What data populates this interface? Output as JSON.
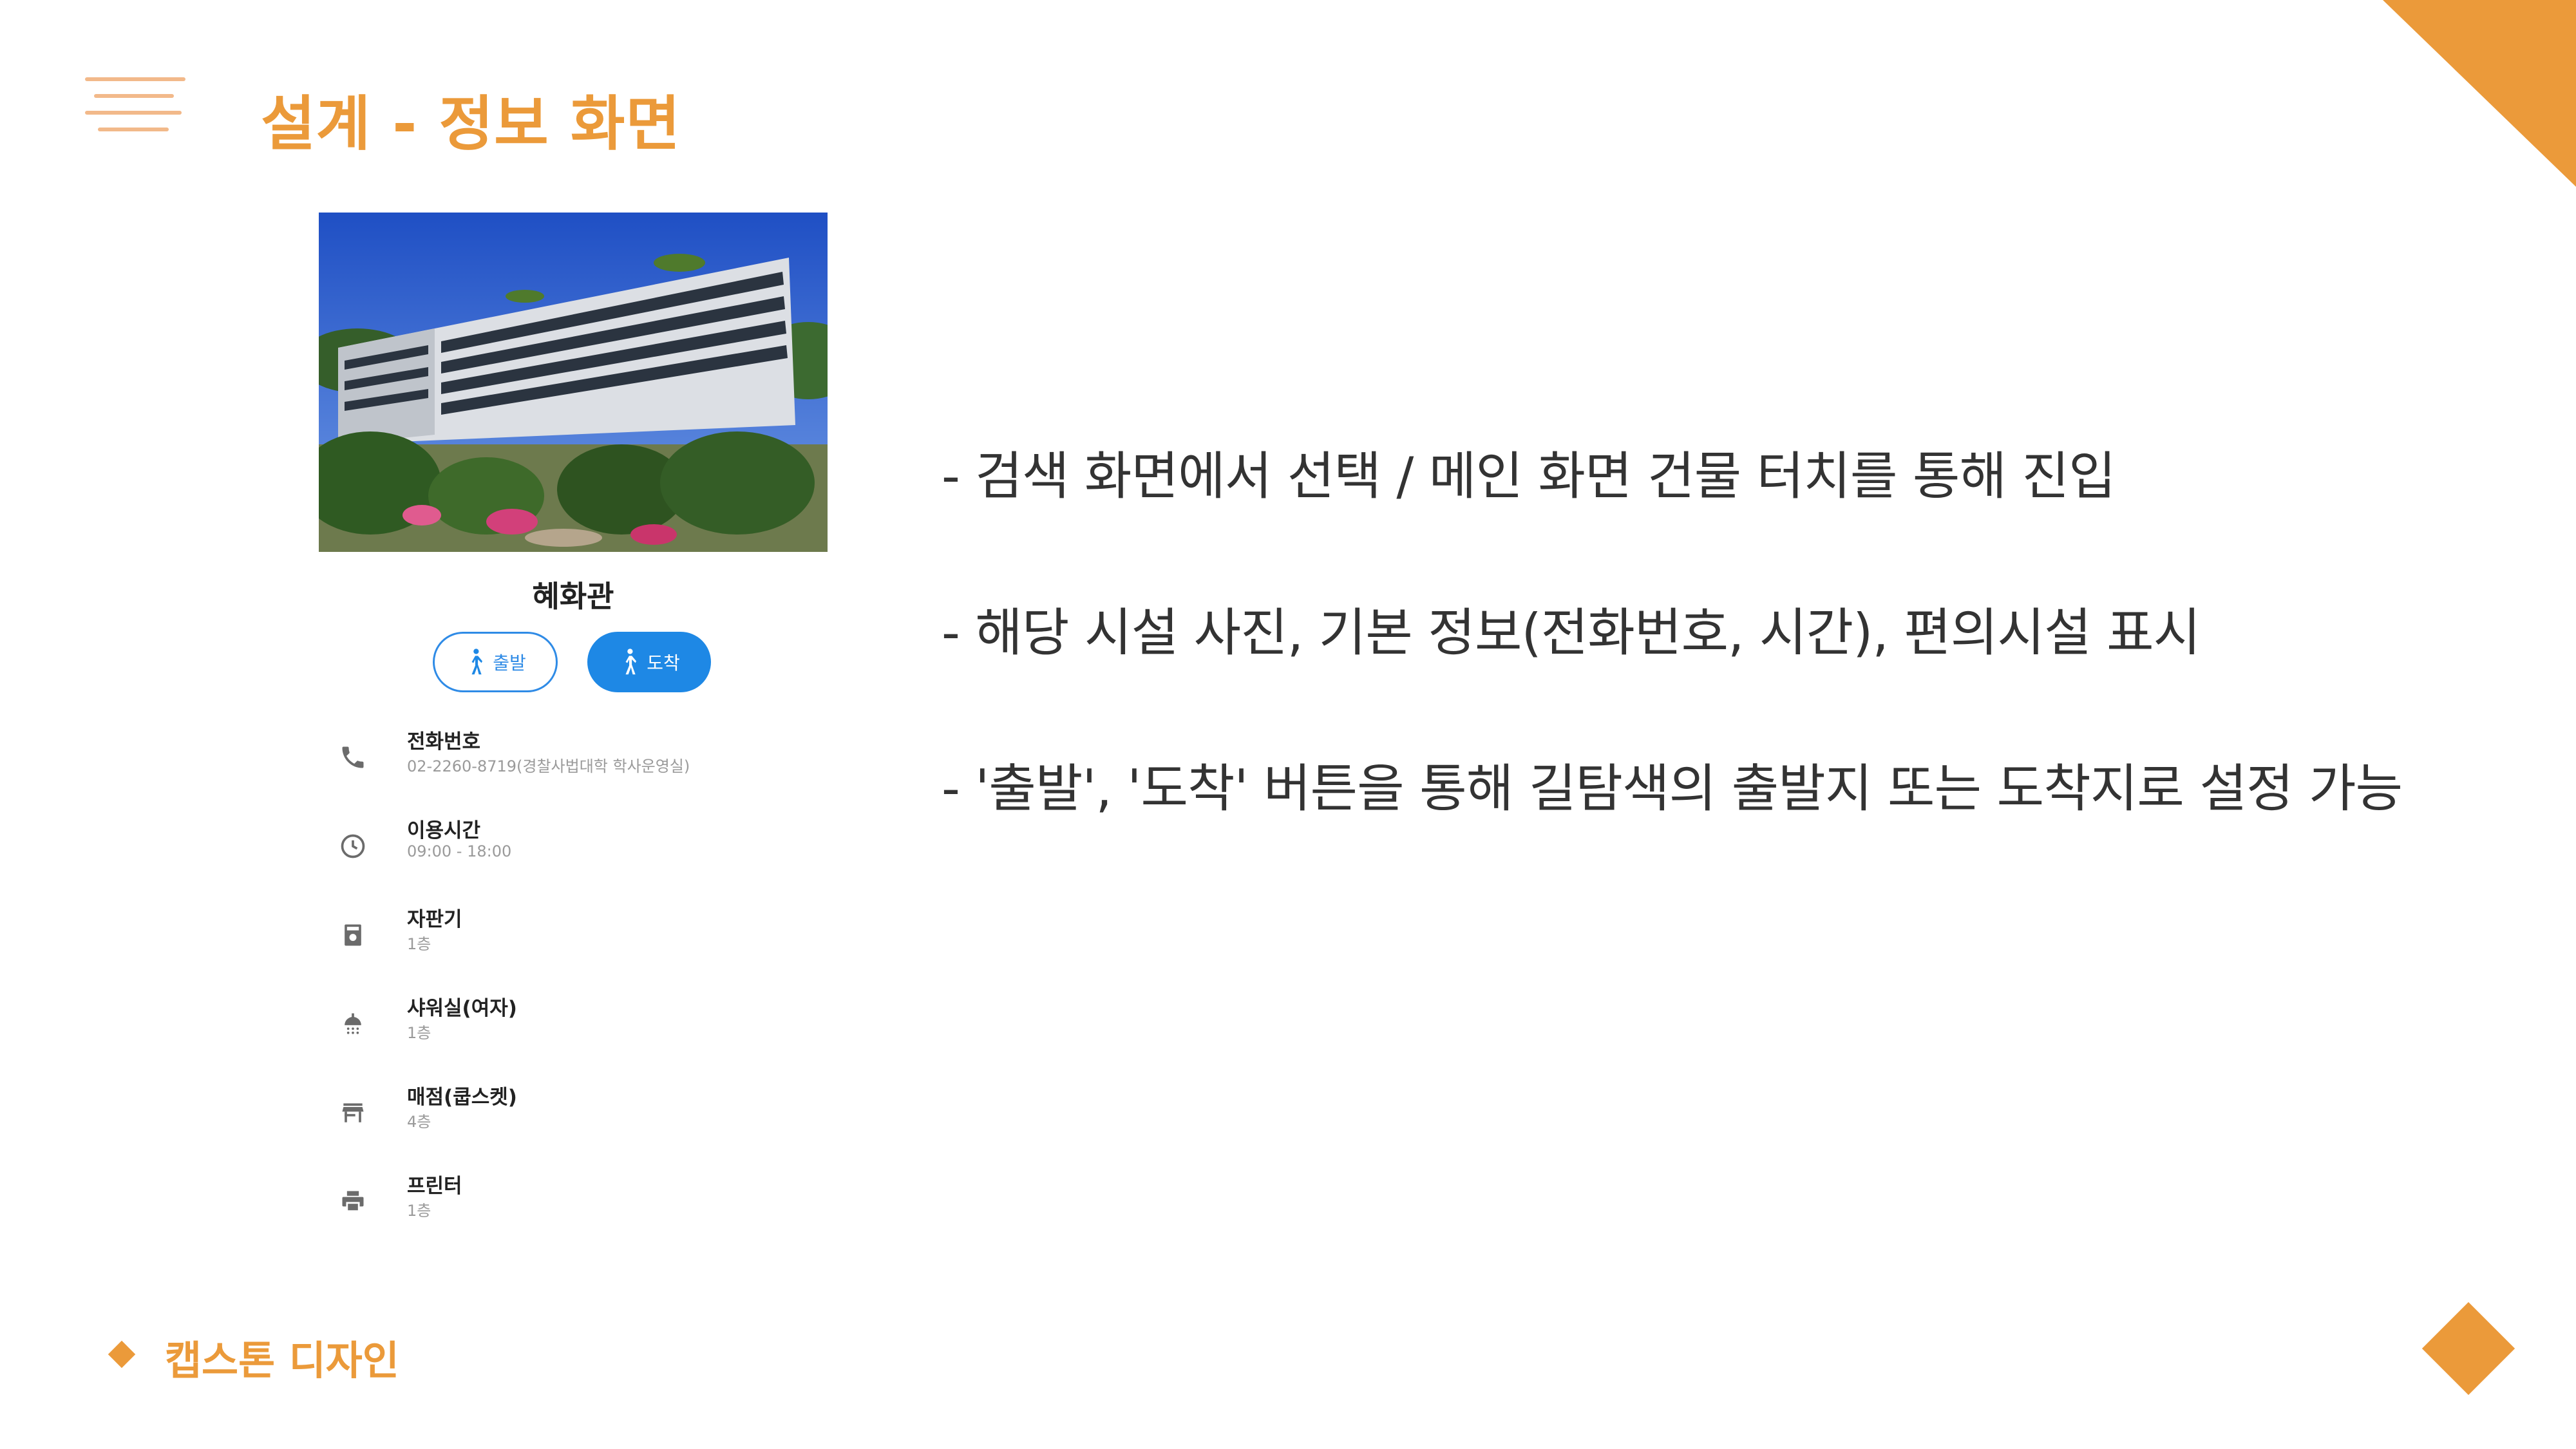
{
  "slide": {
    "title": "설계 - 정보 화면",
    "accent_color": "#EB9A3A",
    "footer_label": "캡스톤 디자인"
  },
  "screen": {
    "building_name": "혜화관",
    "buttons": {
      "depart_label": "출발",
      "arrive_label": "도착",
      "primary_color": "#1E88E5"
    },
    "info_items": [
      {
        "icon": "phone-icon",
        "title": "전화번호",
        "detail": "02-2260-8719(경찰사법대학 학사운영실)"
      },
      {
        "icon": "clock-icon",
        "title": "이용시간",
        "detail": "09:00 - 18:00"
      },
      {
        "icon": "vending-machine-icon",
        "title": "자판기",
        "detail": "1층"
      },
      {
        "icon": "shower-icon",
        "title": "샤워실(여자)",
        "detail": "1층"
      },
      {
        "icon": "store-icon",
        "title": "매점(쿱스켓)",
        "detail": "4층"
      },
      {
        "icon": "printer-icon",
        "title": "프린터",
        "detail": "1층"
      }
    ]
  },
  "bullets": [
    "- 검색 화면에서 선택 / 메인 화면 건물 터치를 통해 진입",
    "-  해당 시설 사진, 기본 정보(전화번호, 시간), 편의시설 표시",
    "- '출발', '도착' 버튼을 통해 길탐색의 출발지 또는 도착지로 설정 가능"
  ]
}
